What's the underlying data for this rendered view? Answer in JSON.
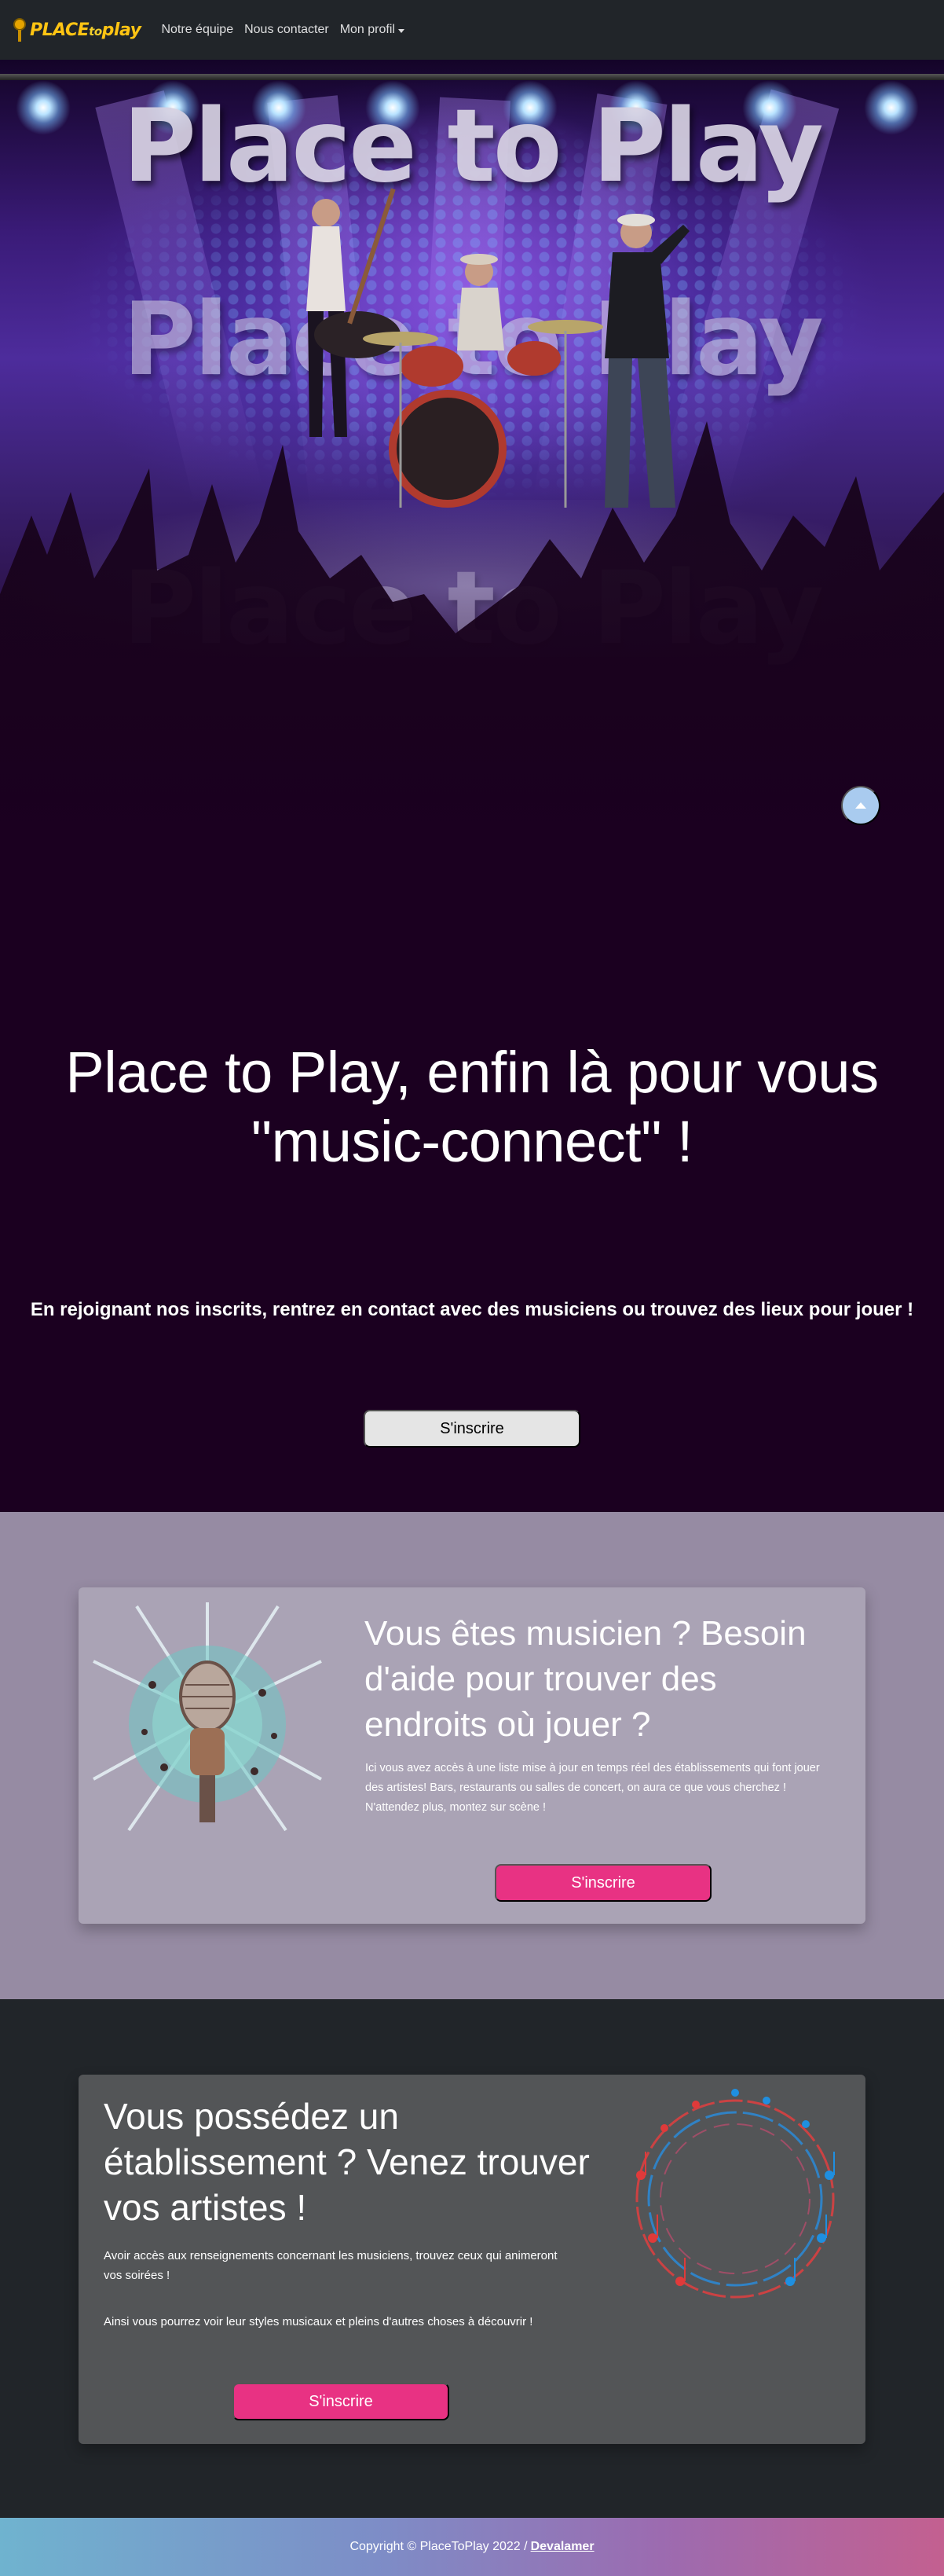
{
  "navbar": {
    "logo_text_a": "PLACE",
    "logo_text_b": "to",
    "logo_text_c": "play",
    "links": [
      {
        "label": "Notre équipe"
      },
      {
        "label": "Nous contacter"
      },
      {
        "label": "Mon profil"
      }
    ]
  },
  "hero": {
    "title": "Place to Play"
  },
  "intro": {
    "heading_line1": "Place to Play, enfin là pour vous",
    "heading_line2": "\"music-connect\" !",
    "lead": "En rejoignant nos inscrits, rentrez en contact avec des musiciens ou trouvez des lieux pour jouer !",
    "button": "S'inscrire"
  },
  "musician": {
    "heading": "Vous êtes musicien ? Besoin d'aide pour trouver des endroits où jouer ?",
    "text": "Ici vous avez accès à une liste mise à jour en temps réel des établissements qui font jouer des artistes! Bars, restaurants ou salles de concert, on aura ce que vous cherchez ! N'attendez plus, montez sur scène !",
    "button": "S'inscrire"
  },
  "venue": {
    "heading": "Vous possédez un établissement ? Venez trouver vos artistes !",
    "text1": "Avoir accès aux renseignements concernant les musiciens, trouvez ceux qui animeront vos soirées !",
    "text2": "Ainsi vous pourrez voir leur styles musicaux et pleins d'autres choses à découvrir !",
    "button": "S'inscrire"
  },
  "footer": {
    "copyright": "Copyright © PlaceToPlay 2022 /",
    "link": "Devalamer"
  },
  "colors": {
    "navbar_bg": "#212529",
    "intro_bg": "#1b0020",
    "accent_pink": "#e83283",
    "musician_section_bg": "#968ba3",
    "venue_section_bg": "#212529",
    "scroll_top_button": "#a9cbef"
  },
  "icons": {
    "scroll_top": "arrow-up-icon",
    "dropdown": "caret-down-icon"
  }
}
